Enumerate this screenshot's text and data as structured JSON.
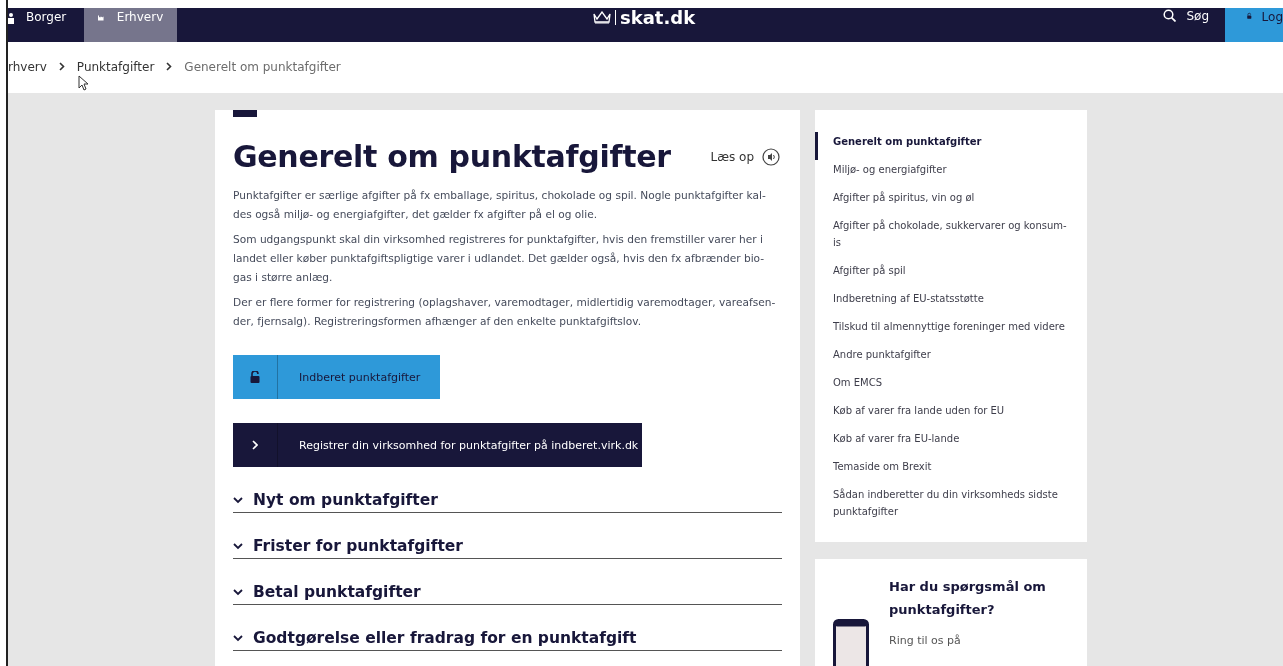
{
  "header": {
    "tabs": [
      {
        "label": "Borger",
        "selected": false
      },
      {
        "label": "Erhverv",
        "selected": true
      }
    ],
    "logo": "skat.dk",
    "search": "Søg",
    "login": "Log"
  },
  "breadcrumb": [
    "rhverv",
    "Punktafgifter",
    "Generelt om punktafgifter"
  ],
  "article": {
    "title": "Generelt om punktafgifter",
    "read_aloud": "Læs op",
    "paragraphs": [
      "Punktafgifter er særlige afgifter på fx emballage, spiritus, chokolade og spil. Nogle punktafgifter kal-des også miljø- og energiafgifter, det gælder fx afgifter på el og olie.",
      "Som udgangspunkt skal din virksomhed registreres for punktafgifter, hvis den fremstiller varer her i landet eller køber punktafgiftspligtige varer i udlandet. Det gælder også, hvis den fx afbrænder bio-gas i større anlæg.",
      "Der er flere former for registrering (oplagshaver, varemodtager, midlertidig varemodtager, vareafsen-der, fjernsalg). Registreringsformen afhænger af den enkelte punktafgiftslov."
    ],
    "buttons": [
      {
        "kind": "login",
        "label": "Indberet punktafgifter"
      },
      {
        "kind": "link",
        "label": "Registrer din virksomhed for punktafgifter på indberet.virk.dk"
      }
    ],
    "accordions": [
      {
        "title": "Nyt om punktafgifter",
        "expanded": false
      },
      {
        "title": "Frister for punktafgifter",
        "expanded": false
      },
      {
        "title": "Betal punktafgifter",
        "expanded": false
      },
      {
        "title": "Godtgørelse eller fradrag for en punktafgift",
        "expanded": false
      }
    ]
  },
  "sidebar": {
    "items": [
      {
        "label": "Generelt om punktafgifter",
        "selected": true
      },
      {
        "label": "Miljø- og energiafgifter",
        "selected": false
      },
      {
        "label": "Afgifter på spiritus, vin og øl",
        "selected": false
      },
      {
        "label": "Afgifter på chokolade, sukkervarer og konsum-is",
        "selected": false
      },
      {
        "label": "Afgifter på spil",
        "selected": false
      },
      {
        "label": "Indberetning af EU-statsstøtte",
        "selected": false
      },
      {
        "label": "Tilskud til almennyttige foreninger med videre",
        "selected": false
      },
      {
        "label": "Andre punktafgifter",
        "selected": false
      },
      {
        "label": "Om EMCS",
        "selected": false
      },
      {
        "label": "Køb af varer fra lande uden for EU",
        "selected": false
      },
      {
        "label": "Køb af varer fra EU-lande",
        "selected": false
      },
      {
        "label": "Temaside om Brexit",
        "selected": false
      },
      {
        "label": "Sådan indberetter du din virksomheds sidste punktafgifter",
        "selected": false
      }
    ]
  },
  "contact": {
    "title": "Har du spørgsmål om punktafgifter?",
    "text": "Ring til os på"
  }
}
